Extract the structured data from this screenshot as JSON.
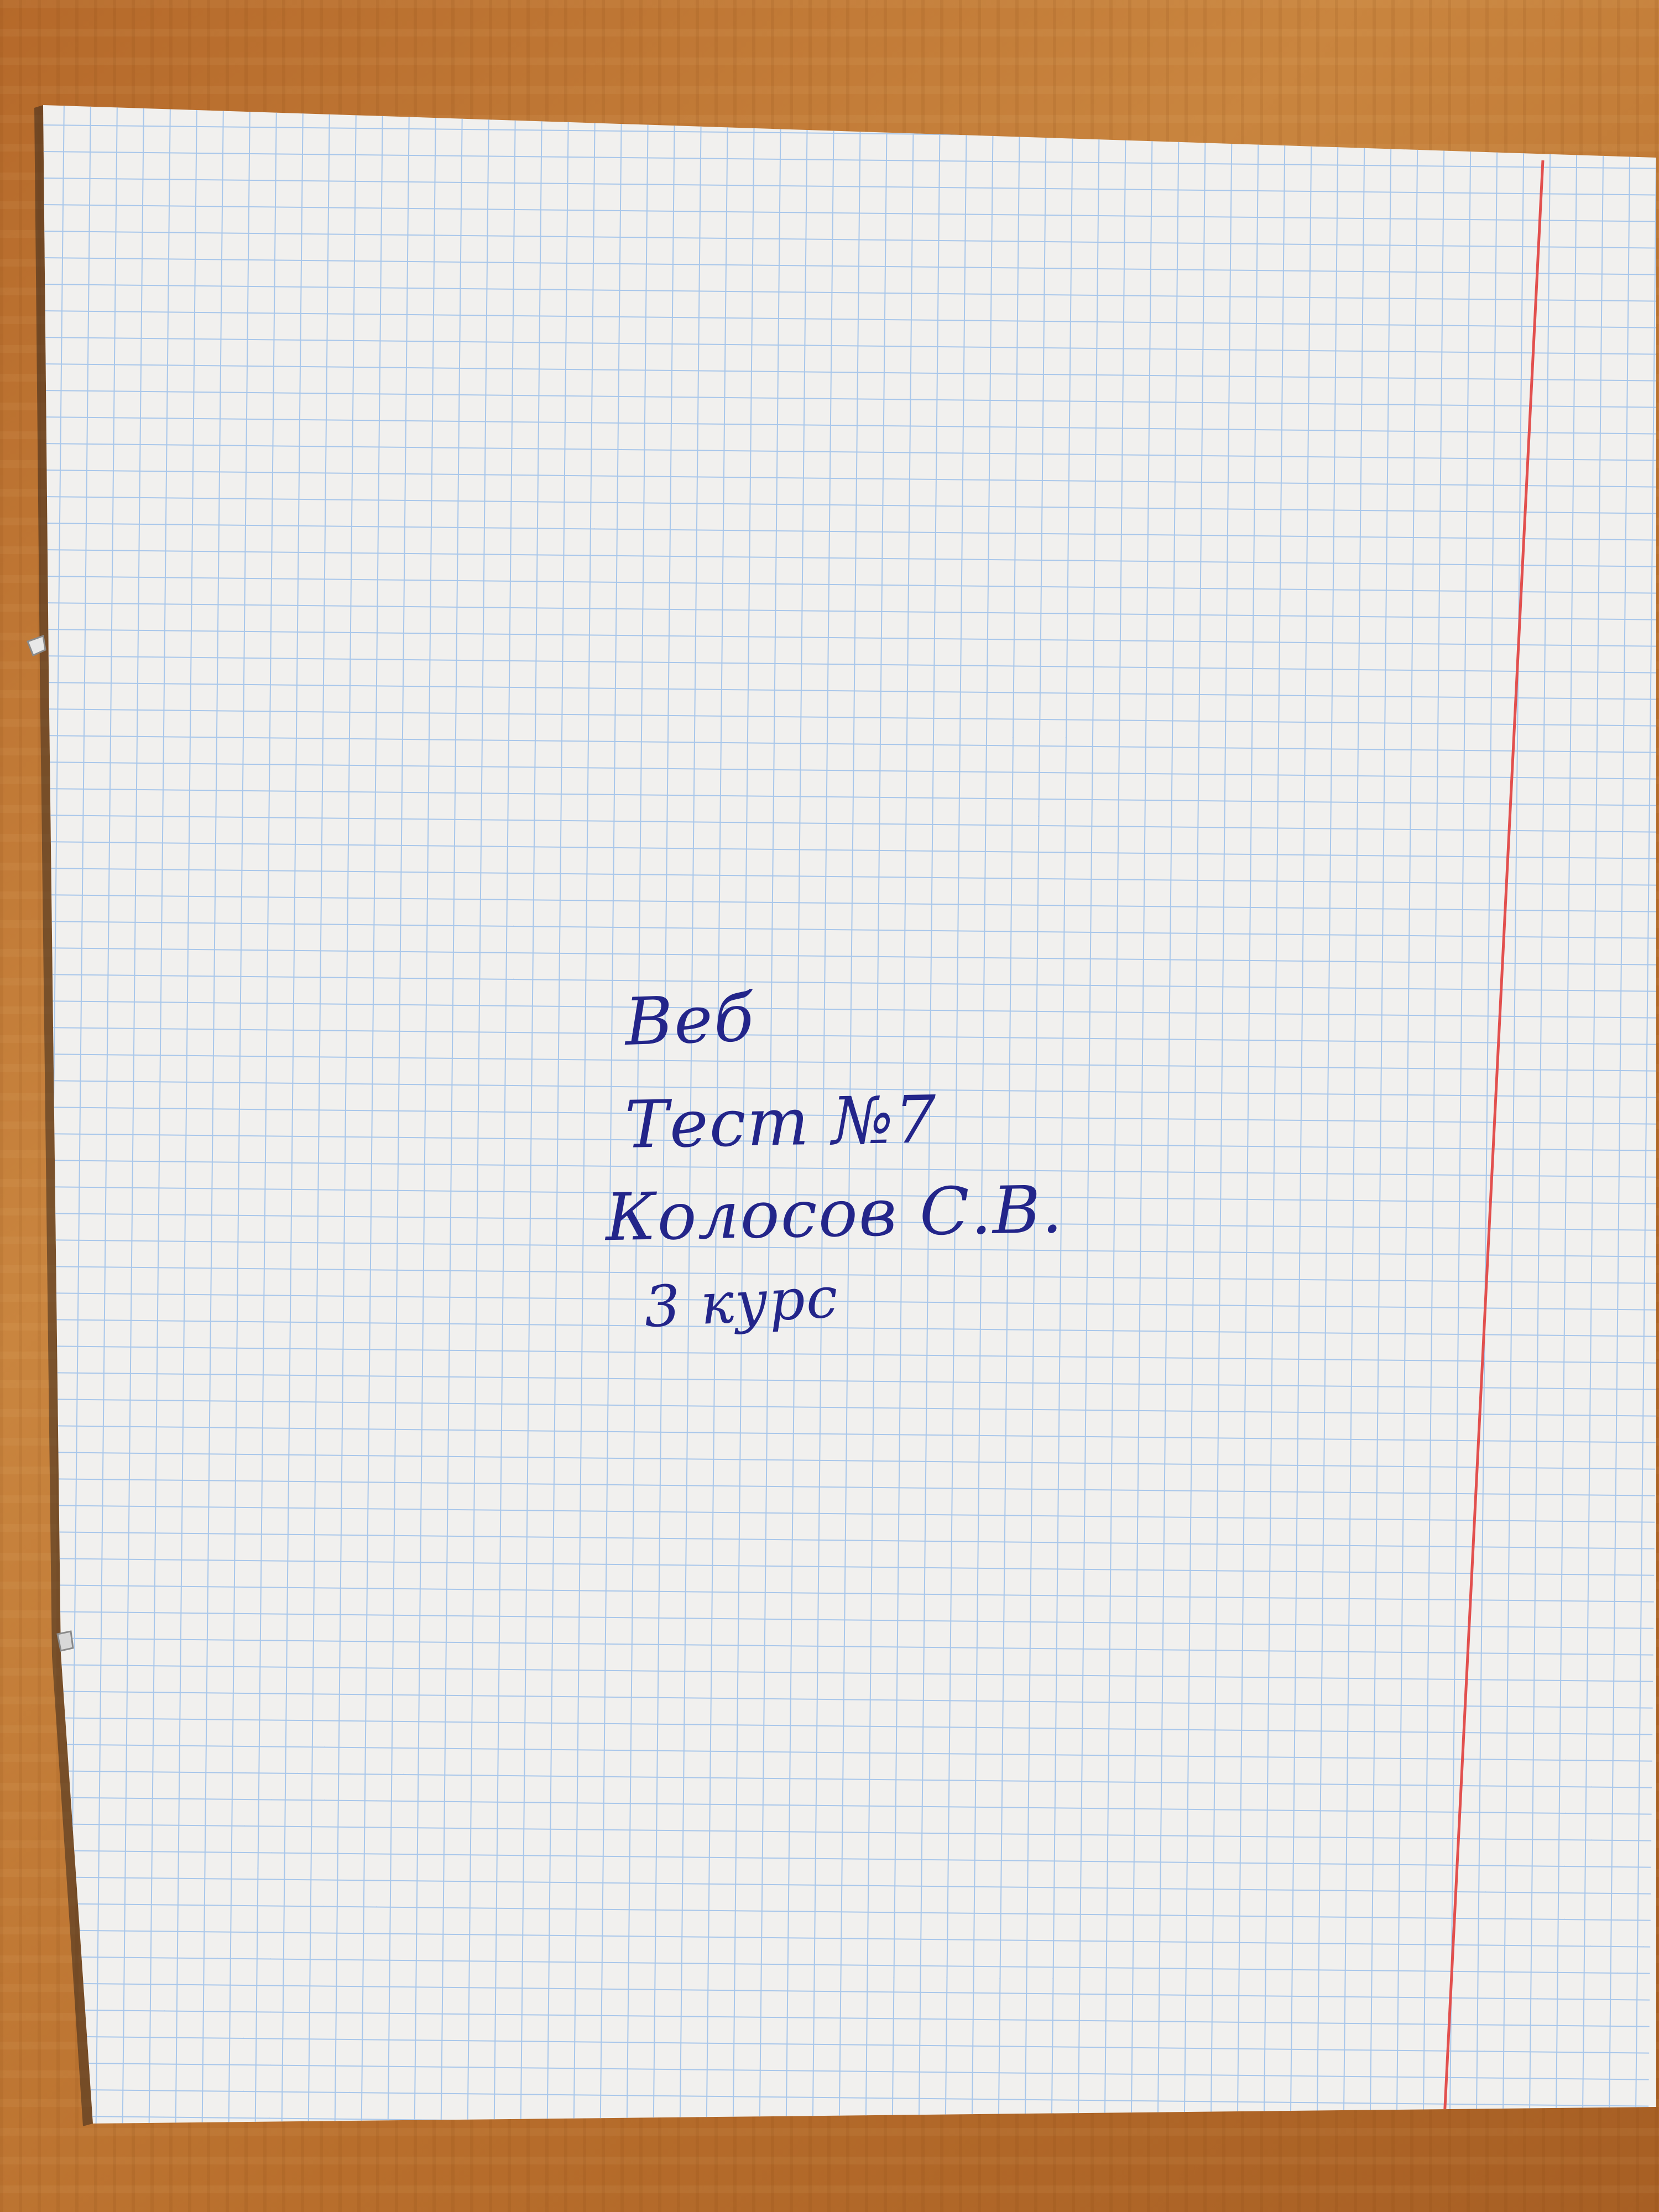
{
  "scene": {
    "subject": "notebook-page",
    "paper": "graph-paper",
    "background": "wooden-table",
    "grid_color": "#a9c7ea",
    "margin_line_color": "#e2504e",
    "paper_color": "#f1f0ee",
    "ink_color": "#23258a",
    "table_color": "#b86e2c"
  },
  "handwriting": {
    "line1": "Веб",
    "line2": "Тест №7",
    "line3": "Колосов С.В.",
    "line4": "3 курс"
  }
}
